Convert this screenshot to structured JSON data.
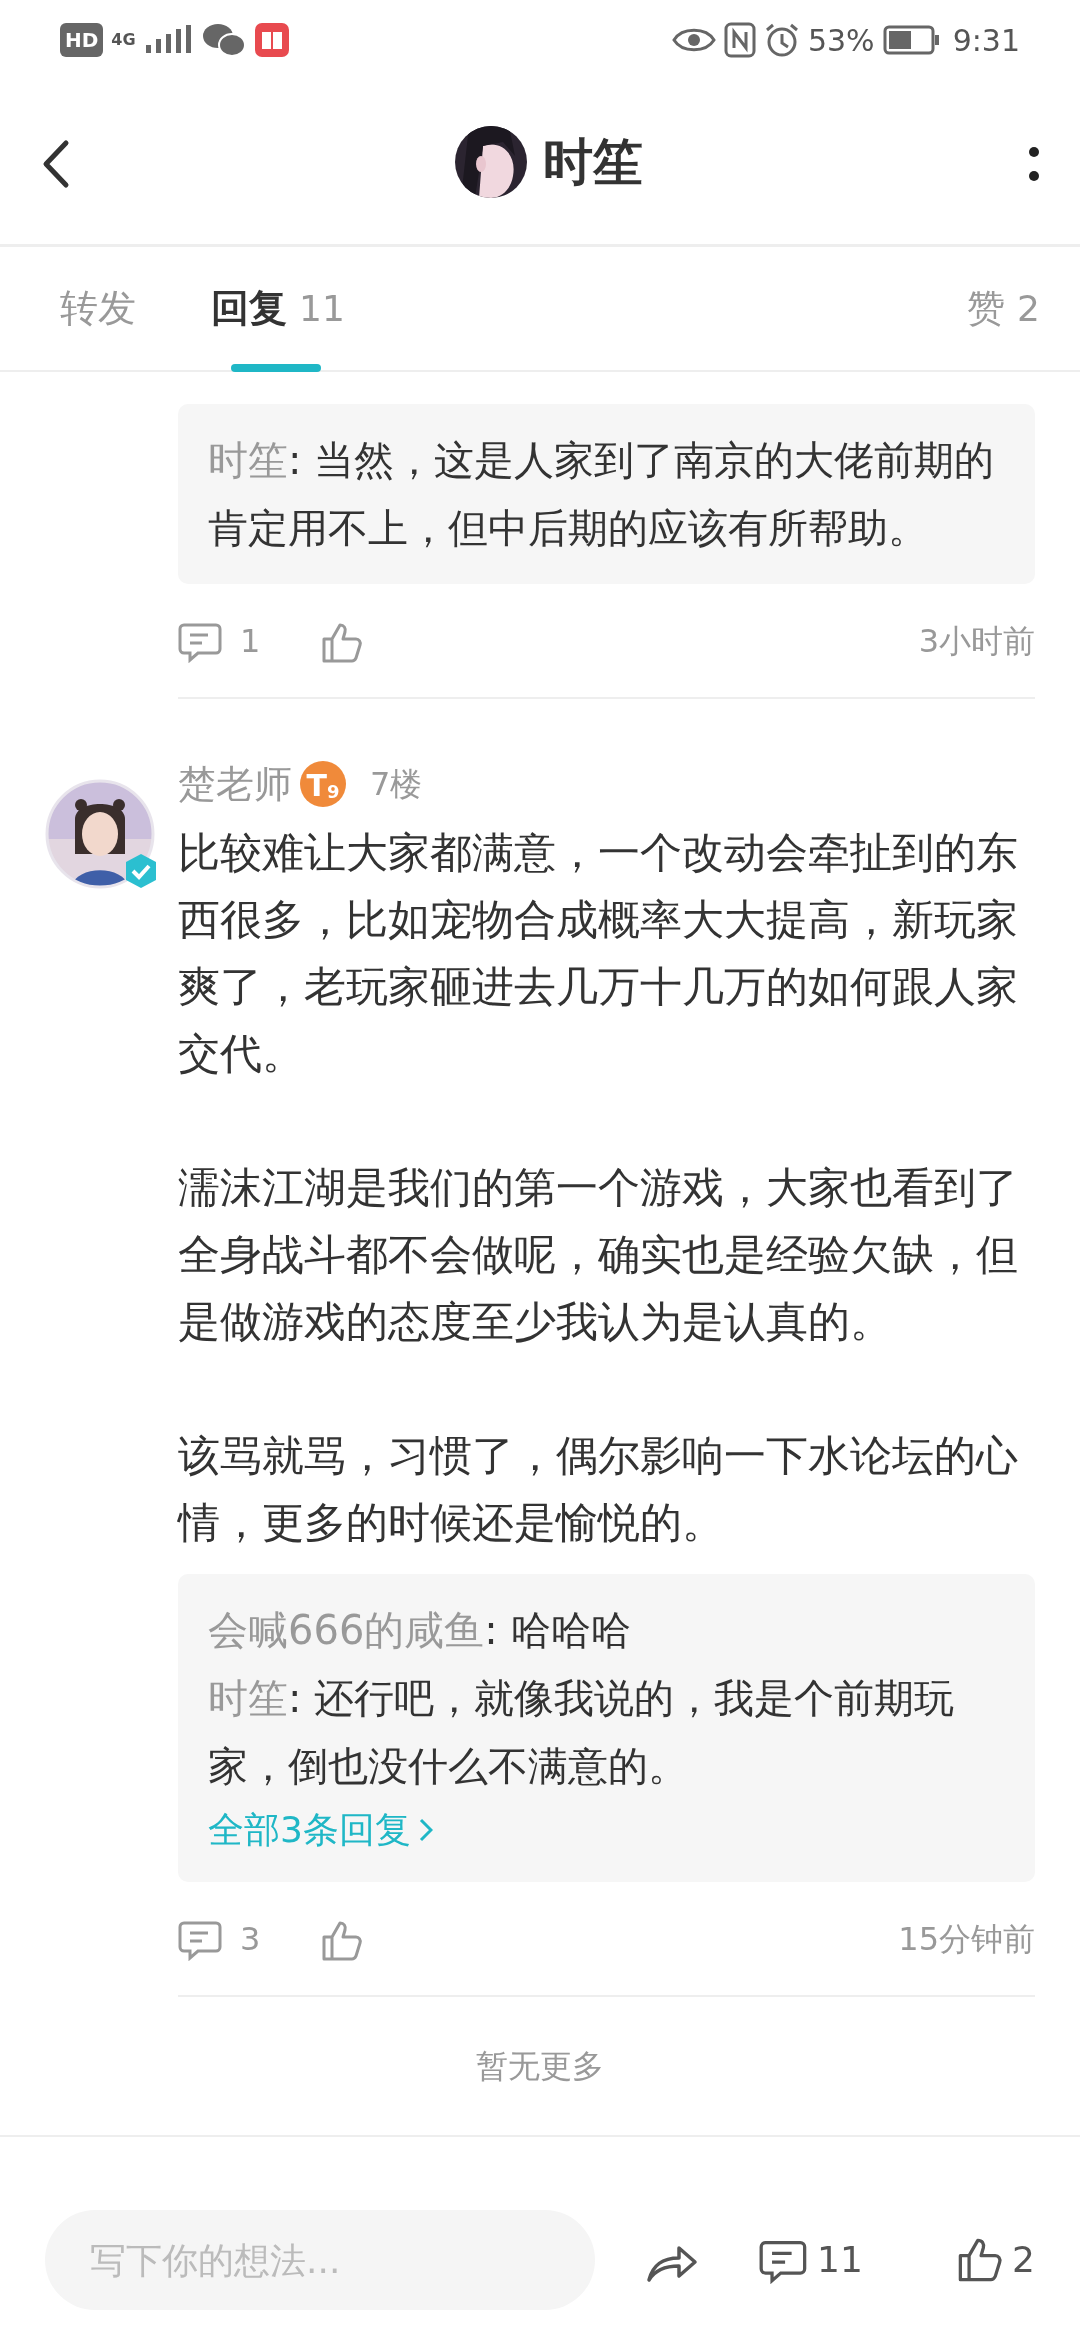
{
  "status_bar": {
    "left": [
      "HD",
      "4G"
    ],
    "battery": "53%",
    "time": "9:31"
  },
  "header": {
    "title": "时笙"
  },
  "tabs": [
    {
      "label": "转发",
      "selected": false
    },
    {
      "label": "回复",
      "count": "11",
      "selected": true
    },
    {
      "label": "赞",
      "count": "2",
      "selected": false
    }
  ],
  "comments": [
    {
      "replies": [
        {
          "author": "时笙",
          "text": ": 当然，这是人家到了南京的大佬前期的肯定用不上，但中后期的应该有所帮助。"
        }
      ],
      "reply_count": "1",
      "time": "3小时前"
    },
    {
      "author": "楚老师",
      "verified": true,
      "level_badge": {
        "letter": "T",
        "number": "9"
      },
      "floor": "7楼",
      "paragraphs": [
        "比较难让大家都满意，一个改动会牵扯到的东西很多，比如宠物合成概率大大提高，新玩家爽了，老玩家砸进去几万十几万的如何跟人家交代。",
        "濡沫江湖是我们的第一个游戏，大家也看到了全身战斗都不会做呢，确实也是经验欠缺，但是做游戏的态度至少我认为是认真的。",
        "该骂就骂，习惯了，偶尔影响一下水论坛的心情，更多的时候还是愉悦的。"
      ],
      "replies": [
        {
          "author": "会喊666的咸鱼",
          "text": ": 哈哈哈"
        },
        {
          "author": "时笙",
          "text": ": 还行吧，就像我说的，我是个前期玩家，倒也没什么不满意的。"
        }
      ],
      "more_link": "全部3条回复",
      "reply_count": "3",
      "time": "15分钟前"
    }
  ],
  "end_note": "暂无更多",
  "bottom_bar": {
    "placeholder": "写下你的想法...",
    "comment_count": "11",
    "like_count": "2"
  }
}
